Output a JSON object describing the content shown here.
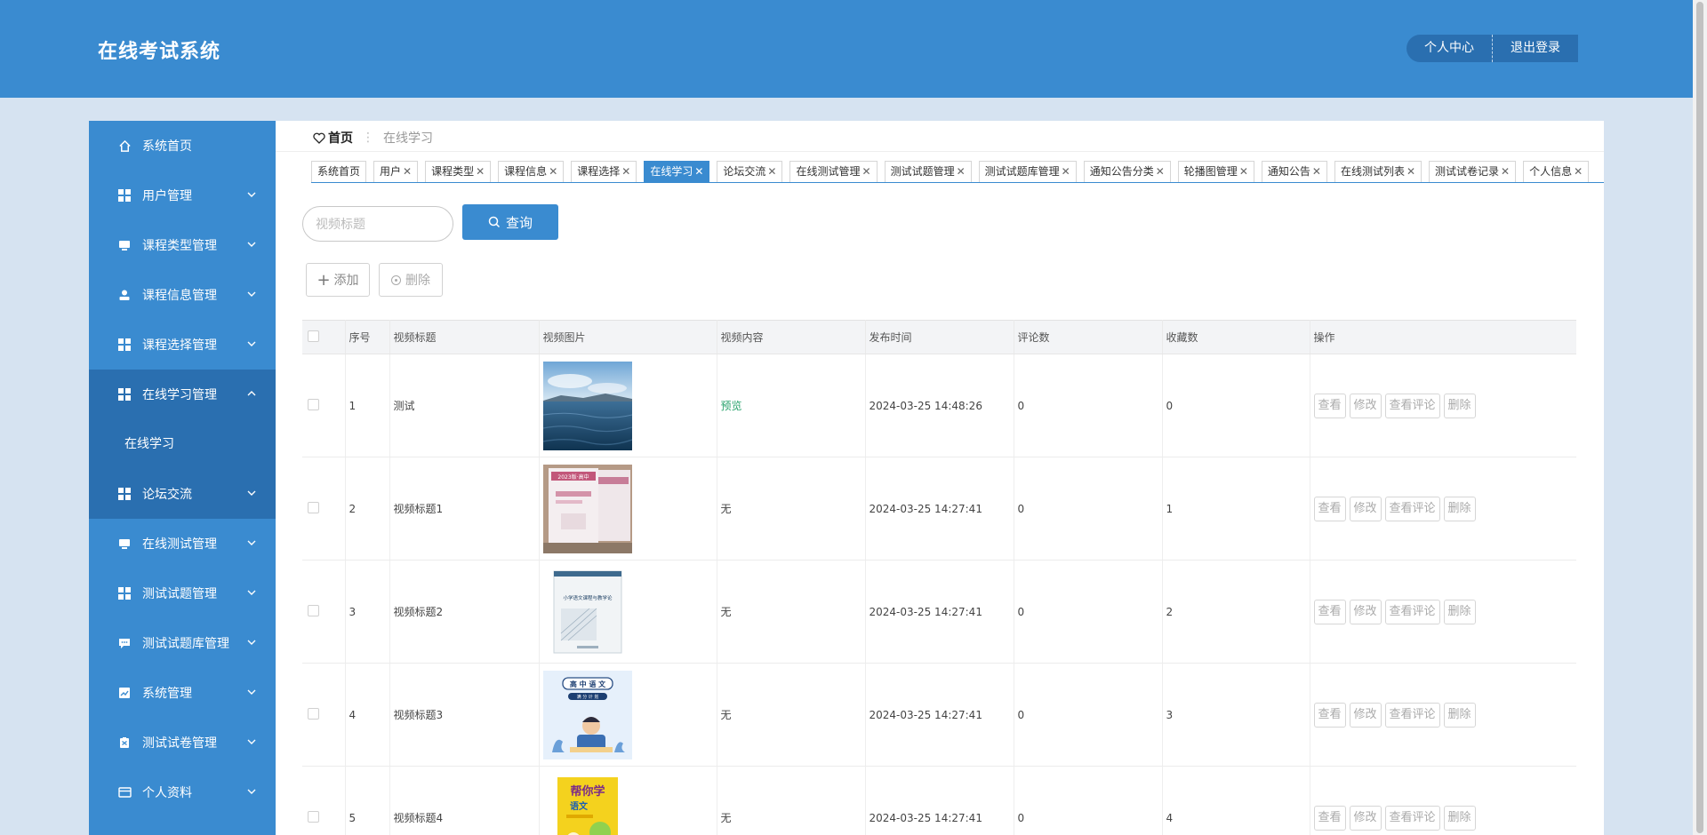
{
  "app": {
    "title": "在线考试系统"
  },
  "header": {
    "personal_center": "个人中心",
    "logout": "退出登录"
  },
  "sidebar": {
    "items": [
      {
        "label": "系统首页",
        "icon": "home-icon"
      },
      {
        "label": "用户管理",
        "icon": "grid-icon"
      },
      {
        "label": "课程类型管理",
        "icon": "monitor-icon"
      },
      {
        "label": "课程信息管理",
        "icon": "user-icon"
      },
      {
        "label": "课程选择管理",
        "icon": "grid-icon"
      },
      {
        "label": "在线学习管理",
        "icon": "grid-icon",
        "expanded": true
      },
      {
        "label": "论坛交流",
        "icon": "grid-icon"
      },
      {
        "label": "在线测试管理",
        "icon": "monitor-icon"
      },
      {
        "label": "测试试题管理",
        "icon": "grid-icon"
      },
      {
        "label": "测试试题库管理",
        "icon": "chat-icon"
      },
      {
        "label": "系统管理",
        "icon": "chart-icon"
      },
      {
        "label": "测试试卷管理",
        "icon": "clipboard-icon"
      },
      {
        "label": "个人资料",
        "icon": "card-icon"
      }
    ],
    "submenu": {
      "label": "在线学习"
    }
  },
  "breadcrumb": {
    "home": "首页",
    "separator": "⋮",
    "current": "在线学习"
  },
  "tabs": [
    {
      "label": "系统首页",
      "closable": false
    },
    {
      "label": "用户",
      "closable": true
    },
    {
      "label": "课程类型",
      "closable": true
    },
    {
      "label": "课程信息",
      "closable": true
    },
    {
      "label": "课程选择",
      "closable": true
    },
    {
      "label": "在线学习",
      "closable": true,
      "active": true
    },
    {
      "label": "论坛交流",
      "closable": true
    },
    {
      "label": "在线测试管理",
      "closable": true
    },
    {
      "label": "测试试题管理",
      "closable": true
    },
    {
      "label": "测试试题库管理",
      "closable": true
    },
    {
      "label": "通知公告分类",
      "closable": true
    },
    {
      "label": "轮播图管理",
      "closable": true
    },
    {
      "label": "通知公告",
      "closable": true
    },
    {
      "label": "在线测试列表",
      "closable": true
    },
    {
      "label": "测试试卷记录",
      "closable": true
    },
    {
      "label": "个人信息",
      "closable": true
    }
  ],
  "search": {
    "placeholder": "视频标题",
    "button": "查询"
  },
  "toolbar": {
    "add": "添加",
    "delete": "删除"
  },
  "table": {
    "headers": [
      "序号",
      "视频标题",
      "视频图片",
      "视频内容",
      "发布时间",
      "评论数",
      "收藏数",
      "操作"
    ],
    "rows": [
      {
        "no": "1",
        "title": "测试",
        "image": "sea-image",
        "content": "预览",
        "time": "2024-03-25 14:48:26",
        "comments": "0",
        "favorites": "0"
      },
      {
        "no": "2",
        "title": "视频标题1",
        "image": "books-image",
        "content": "无",
        "time": "2024-03-25 14:27:41",
        "comments": "0",
        "favorites": "1"
      },
      {
        "no": "3",
        "title": "视频标题2",
        "image": "book-cover-image",
        "content": "无",
        "time": "2024-03-25 14:27:41",
        "comments": "0",
        "favorites": "2"
      },
      {
        "no": "4",
        "title": "视频标题3",
        "image": "chinese-book-image",
        "content": "无",
        "time": "2024-03-25 14:27:41",
        "comments": "0",
        "favorites": "3"
      },
      {
        "no": "5",
        "title": "视频标题4",
        "image": "yellow-book-image",
        "content": "无",
        "time": "2024-03-25 14:27:41",
        "comments": "0",
        "favorites": "4"
      }
    ],
    "actions": [
      "查看",
      "修改",
      "查看评论",
      "删除"
    ]
  },
  "thumb_texts": {
    "books": "2023版·高中",
    "book2": "小学语文课程与教学论",
    "chinese_title": "高 中 语 文",
    "chinese_sub": "满 分 计 划",
    "yellow_title": "帮你学",
    "yellow_sub": "语文"
  },
  "colors": {
    "primary": "#3a8bd0",
    "primary_dark": "#2a6fb0",
    "page_bg": "#d6e3f1",
    "preview_link": "#27a26b"
  }
}
